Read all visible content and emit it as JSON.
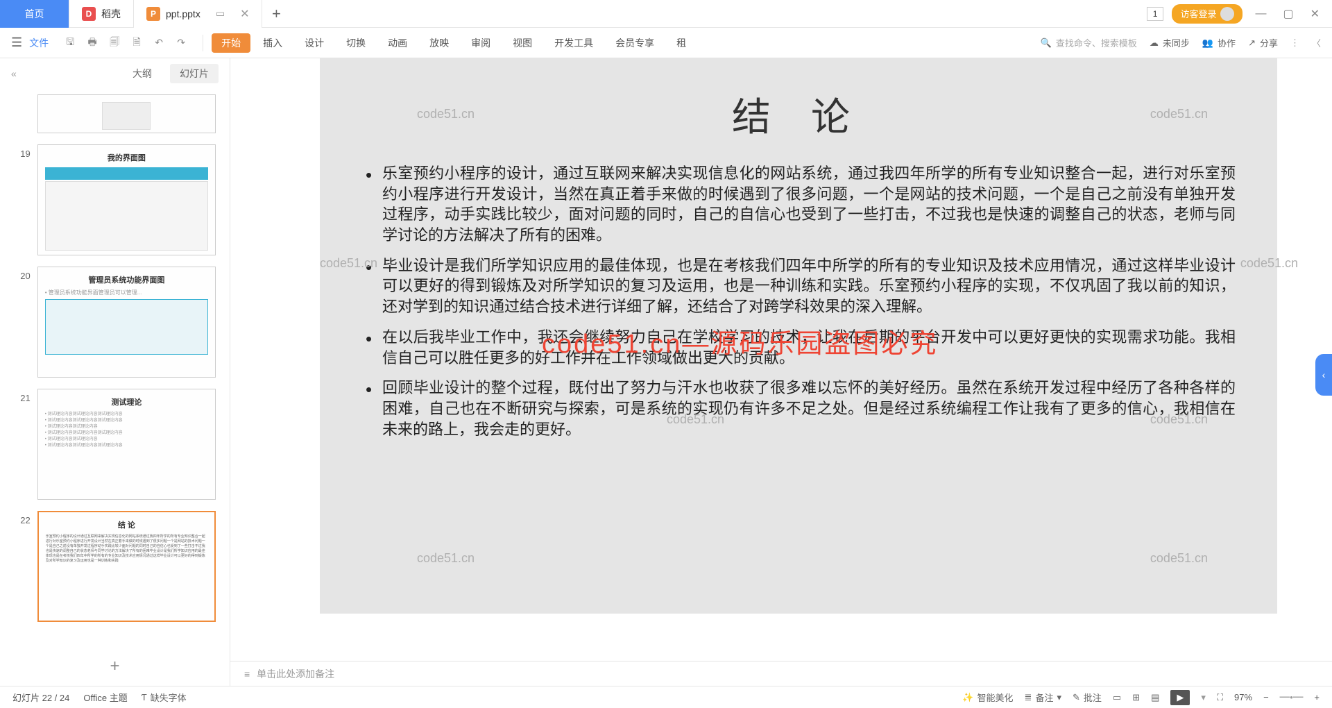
{
  "titlebar": {
    "home": "首页",
    "tab2": "稻壳",
    "tab3": "ppt.pptx",
    "number_badge": "1",
    "login": "访客登录"
  },
  "ribbon": {
    "file": "文件",
    "tabs": [
      "开始",
      "插入",
      "设计",
      "切换",
      "动画",
      "放映",
      "审阅",
      "视图",
      "开发工具",
      "会员专享",
      "租"
    ],
    "search_placeholder": "查找命令、搜索模板",
    "sync": "未同步",
    "coop": "协作",
    "share": "分享"
  },
  "side": {
    "outline": "大纲",
    "slides": "幻灯片",
    "thumbs": [
      {
        "num": "",
        "title": ""
      },
      {
        "num": "19",
        "title": "我的界面图"
      },
      {
        "num": "20",
        "title": "管理员系统功能界面图"
      },
      {
        "num": "21",
        "title": "测试理论"
      },
      {
        "num": "22",
        "title": "结 论"
      }
    ],
    "add": "+"
  },
  "slide": {
    "title": "结 论",
    "bullets": [
      "乐室预约小程序的设计，通过互联网来解决实现信息化的网站系统，通过我四年所学的所有专业知识整合一起，进行对乐室预约小程序进行开发设计，当然在真正着手来做的时候遇到了很多问题，一个是网站的技术问题，一个是自己之前没有单独开发过程序，动手实践比较少，面对问题的同时，自己的自信心也受到了一些打击，不过我也是快速的调整自己的状态，老师与同学讨论的方法解决了所有的困难。",
      "毕业设计是我们所学知识应用的最佳体现，也是在考核我们四年中所学的所有的专业知识及技术应用情况，通过这样毕业设计可以更好的得到锻炼及对所学知识的复习及运用，也是一种训练和实践。乐室预约小程序的实现，不仅巩固了我以前的知识，还对学到的知识通过结合技术进行详细了解，还结合了对跨学科效果的深入理解。",
      "在以后我毕业工作中，我还会继续努力自己在学校学习的技术，让我在后期的平台开发中可以更好更快的实现需求功能。我相信自己可以胜任更多的好工作并在工作领域做出更大的贡献。",
      "回顾毕业设计的整个过程，既付出了努力与汗水也收获了很多难以忘怀的美好经历。虽然在系统开发过程中经历了各种各样的困难，自己也在不断研究与探索，可是系统的实现仍有许多不足之处。但是经过系统编程工作让我有了更多的信心，我相信在未来的路上，我会走的更好。"
    ],
    "watermark": "code51.cn",
    "red_overlay": "code51.cn—源码乐园盗图必究"
  },
  "notes": {
    "icon": "≡",
    "placeholder": "单击此处添加备注"
  },
  "statusbar": {
    "slide_info": "幻灯片 22 / 24",
    "theme": "Office 主题",
    "missing_font": "缺失字体",
    "smart_beautify": "智能美化",
    "notes_btn": "备注",
    "comments": "批注",
    "zoom": "97%"
  }
}
